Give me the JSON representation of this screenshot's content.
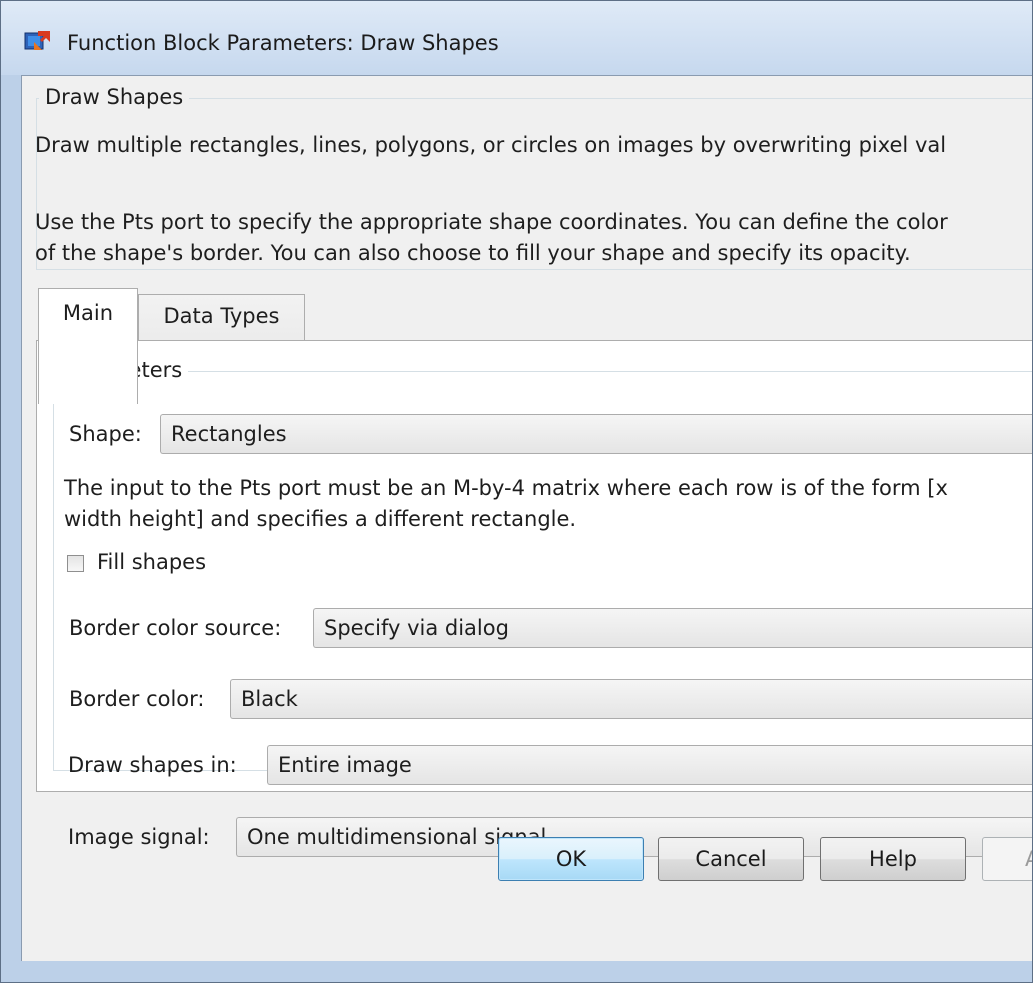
{
  "window": {
    "title": "Function Block Parameters: Draw Shapes"
  },
  "description": {
    "group_title": "Draw Shapes",
    "line1": "Draw multiple rectangles, lines, polygons, or circles on images by overwriting pixel val",
    "line2": "Use the Pts port to specify the appropriate shape coordinates. You can define the color",
    "line3": "of the shape's border. You can also choose to fill your shape and specify its opacity."
  },
  "tabs": [
    {
      "label": "Main",
      "active": true
    },
    {
      "label": "Data Types",
      "active": false
    }
  ],
  "parameters": {
    "group_title": "Parameters",
    "shape_label": "Shape:",
    "shape_value": "Rectangles",
    "info_line1": "The input to the Pts port must be an M-by-4 matrix where each row is of the form [x",
    "info_line2": "width height] and specifies a different rectangle.",
    "fill_shapes_label": "Fill shapes",
    "fill_shapes_checked": false,
    "border_color_source_label": "Border color source:",
    "border_color_source_value": "Specify via dialog",
    "border_color_label": "Border color:",
    "border_color_value": "Black",
    "draw_shapes_in_label": "Draw shapes in:",
    "draw_shapes_in_value": "Entire image",
    "image_signal_label": "Image signal:",
    "image_signal_value": "One multidimensional signal"
  },
  "buttons": {
    "ok": "OK",
    "cancel": "Cancel",
    "help": "Help",
    "apply": "A"
  },
  "icons": {
    "app": "simulink-block-icon",
    "checkbox": "checkbox-unchecked-icon"
  },
  "colors": {
    "window_frame": "#bcd0e8",
    "default_button": "#bee6fd"
  }
}
